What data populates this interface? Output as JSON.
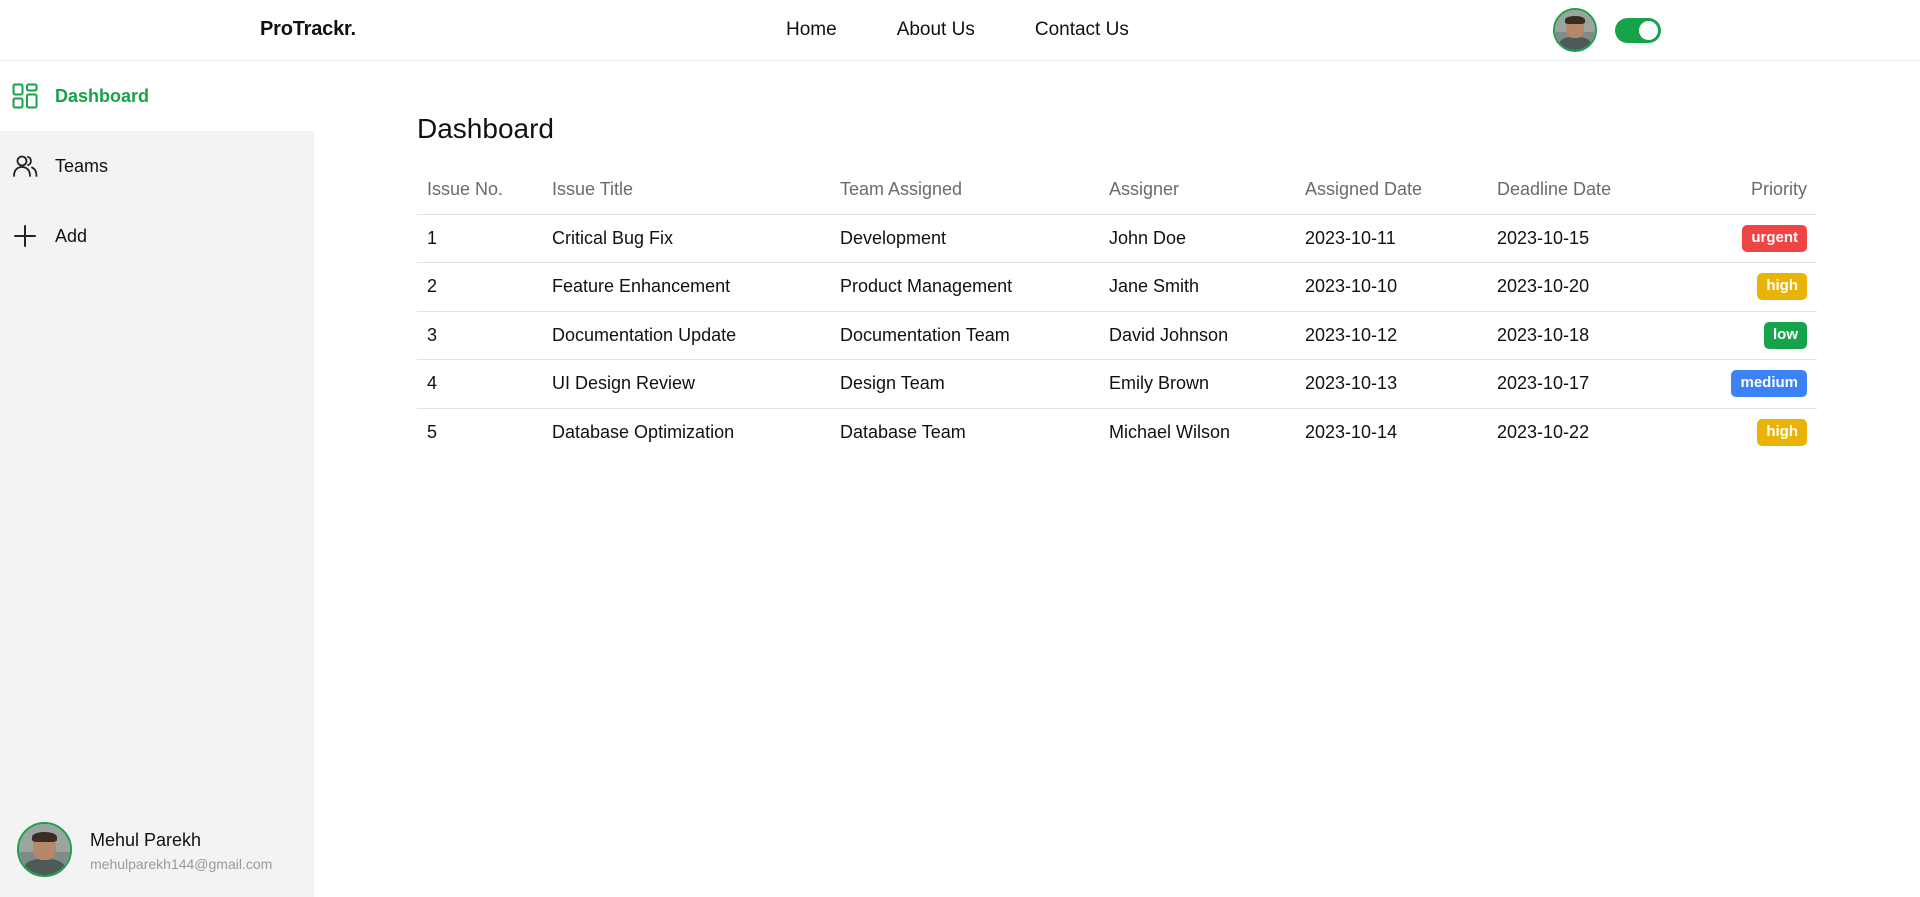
{
  "navbar": {
    "brand": "ProTrackr.",
    "links": [
      "Home",
      "About Us",
      "Contact Us"
    ],
    "theme_toggle_on": true
  },
  "sidebar": {
    "items": [
      {
        "label": "Dashboard",
        "icon": "dashboard-grid-icon",
        "active": true
      },
      {
        "label": "Teams",
        "icon": "users-icon",
        "active": false
      },
      {
        "label": "Add",
        "icon": "plus-icon",
        "active": false
      }
    ],
    "user": {
      "name": "Mehul Parekh",
      "email": "mehulparekh144@gmail.com"
    }
  },
  "main": {
    "title": "Dashboard",
    "columns": [
      "Issue No.",
      "Issue Title",
      "Team Assigned",
      "Assigner",
      "Assigned Date",
      "Deadline Date",
      "Priority"
    ],
    "rows": [
      {
        "no": "1",
        "title": "Critical Bug Fix",
        "team": "Development",
        "assigner": "John Doe",
        "assigned": "2023-10-11",
        "deadline": "2023-10-15",
        "priority": "urgent"
      },
      {
        "no": "2",
        "title": "Feature Enhancement",
        "team": "Product Management",
        "assigner": "Jane Smith",
        "assigned": "2023-10-10",
        "deadline": "2023-10-20",
        "priority": "high"
      },
      {
        "no": "3",
        "title": "Documentation Update",
        "team": "Documentation Team",
        "assigner": "David Johnson",
        "assigned": "2023-10-12",
        "deadline": "2023-10-18",
        "priority": "low"
      },
      {
        "no": "4",
        "title": "UI Design Review",
        "team": "Design Team",
        "assigner": "Emily Brown",
        "assigned": "2023-10-13",
        "deadline": "2023-10-17",
        "priority": "medium"
      },
      {
        "no": "5",
        "title": "Database Optimization",
        "team": "Database Team",
        "assigner": "Michael Wilson",
        "assigned": "2023-10-14",
        "deadline": "2023-10-22",
        "priority": "high"
      }
    ]
  },
  "colors": {
    "accent": "#16a34a",
    "priority": {
      "urgent": "#ef4444",
      "high": "#eab308",
      "low": "#16a34a",
      "medium": "#3b82f6"
    }
  }
}
